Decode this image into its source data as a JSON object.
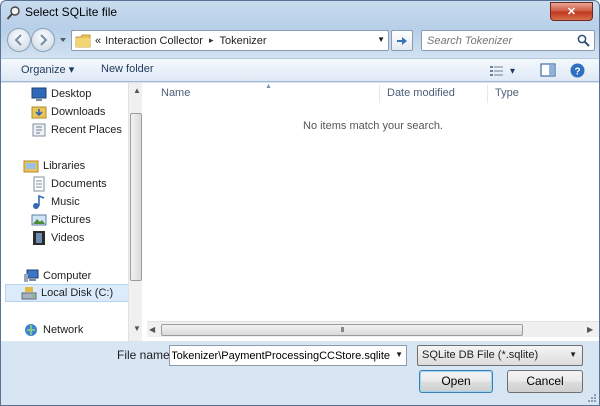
{
  "window": {
    "title": "Select SQLite file",
    "close_symbol": "✕"
  },
  "navbar": {
    "breadcrumb_prefix": "«",
    "breadcrumb": [
      "Interaction Collector",
      "Tokenizer"
    ],
    "breadcrumb_sep": "▸",
    "search_placeholder": "Search Tokenizer"
  },
  "toolbar": {
    "organize_label": "Organize ▾",
    "new_folder_label": "New folder",
    "views_arrow": "▾"
  },
  "nav_pane": {
    "items": [
      {
        "label": "Desktop",
        "icon": "desktop-icon"
      },
      {
        "label": "Downloads",
        "icon": "downloads-folder-icon"
      },
      {
        "label": "Recent Places",
        "icon": "recent-places-icon"
      },
      {
        "label": "Libraries",
        "icon": "libraries-icon"
      },
      {
        "label": "Documents",
        "icon": "documents-icon"
      },
      {
        "label": "Music",
        "icon": "music-icon"
      },
      {
        "label": "Pictures",
        "icon": "pictures-icon"
      },
      {
        "label": "Videos",
        "icon": "videos-icon"
      },
      {
        "label": "Computer",
        "icon": "computer-icon"
      },
      {
        "label": "Local Disk (C:)",
        "icon": "local-disk-icon",
        "selected": true
      },
      {
        "label": "Network",
        "icon": "network-icon"
      }
    ]
  },
  "file_pane": {
    "columns": [
      "Name",
      "Date modified",
      "Type"
    ],
    "empty_message": "No items match your search.",
    "hscroll_grip": "III"
  },
  "bottom": {
    "file_name_label": "File name:",
    "file_name_value": "C:\\Interaction Collector\\Tokenizer\\PaymentProcessingCCStore.sqlite",
    "file_type_value": "SQLite DB File (*.sqlite)",
    "open_label": "Open",
    "cancel_label": "Cancel"
  },
  "colors": {
    "title_bg": "#c9dcef",
    "close_red": "#c0391f",
    "link_blue": "#1e395b",
    "selection_bg": "#dcebfc"
  }
}
